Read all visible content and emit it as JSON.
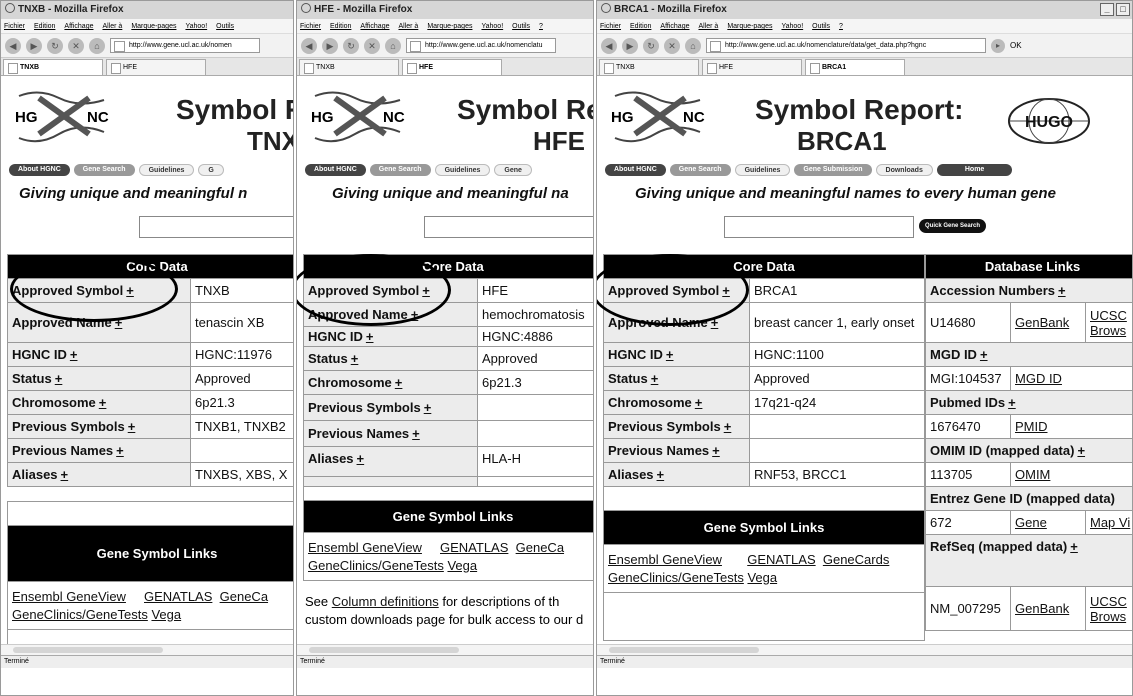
{
  "windows": [
    {
      "title": "TNXB - Mozilla Firefox",
      "menu": [
        "Fichier",
        "Edition",
        "Affichage",
        "Aller à",
        "Marque-pages",
        "Yahoo!",
        "Outils"
      ],
      "url": "http://www.gene.ucl.ac.uk/nomen",
      "tabs": [
        "TNXB",
        "HFE"
      ],
      "header_line1": "Symbol R",
      "header_line2": "TNX",
      "buttons": [
        "About HGNC",
        "Gene Search",
        "Guidelines",
        "G"
      ],
      "tagline": "Giving unique and meaningful n",
      "core_title": "Core Data",
      "rows": [
        {
          "label": "Approved Symbol",
          "value": "TNXB"
        },
        {
          "label": "Approved Name",
          "value": "tenascin XB"
        },
        {
          "label": "HGNC ID",
          "value": "HGNC:11976"
        },
        {
          "label": "Status",
          "value": "Approved"
        },
        {
          "label": "Chromosome",
          "value": "6p21.3"
        },
        {
          "label": "Previous Symbols",
          "value": "TNXB1, TNXB2"
        },
        {
          "label": "Previous Names",
          "value": ""
        },
        {
          "label": "Aliases",
          "value": "TNXBS, XBS, X"
        }
      ],
      "links_title": "Gene Symbol Links",
      "links": [
        "Ensembl GeneView",
        "GENATLAS",
        "GeneCa"
      ],
      "links2": [
        "GeneClinics/GeneTests",
        "Vega"
      ],
      "status_text": "Terminé"
    },
    {
      "title": "HFE - Mozilla Firefox",
      "menu": [
        "Fichier",
        "Edition",
        "Affichage",
        "Aller à",
        "Marque-pages",
        "Yahoo!",
        "Outils",
        "?"
      ],
      "url": "http://www.gene.ucl.ac.uk/nomenclatu",
      "tabs": [
        "TNXB",
        "HFE"
      ],
      "header_line1": "Symbol Re",
      "header_line2": "HFE",
      "buttons": [
        "About HGNC",
        "Gene Search",
        "Guidelines",
        "Gene"
      ],
      "tagline": "Giving unique and meaningful na",
      "core_title": "Core Data",
      "rows": [
        {
          "label": "Approved Symbol",
          "value": "HFE"
        },
        {
          "label": "Approved Name",
          "value": "hemochromatosis"
        },
        {
          "label": "HGNC ID",
          "value": "HGNC:4886"
        },
        {
          "label": "Status",
          "value": "Approved"
        },
        {
          "label": "Chromosome",
          "value": "6p21.3"
        },
        {
          "label": "Previous Symbols",
          "value": ""
        },
        {
          "label": "Previous Names",
          "value": ""
        },
        {
          "label": "Aliases",
          "value": "HLA-H"
        }
      ],
      "links_title": "Gene Symbol Links",
      "links": [
        "Ensembl GeneView",
        "GENATLAS",
        "GeneCa"
      ],
      "links2": [
        "GeneClinics/GeneTests",
        "Vega"
      ],
      "note_line1_pre": "See",
      "note_line1_link": "Column definitions",
      "note_line1_post": "for descriptions of th",
      "note_line2": "custom downloads page for bulk access to our d",
      "status_text": "Terminé"
    },
    {
      "title": "BRCA1 - Mozilla Firefox",
      "menu": [
        "Fichier",
        "Edition",
        "Affichage",
        "Aller à",
        "Marque-pages",
        "Yahoo!",
        "Outils",
        "?"
      ],
      "url": "http://www.gene.ucl.ac.uk/nomenclature/data/get_data.php?hgnc",
      "ok_label": "OK",
      "tabs": [
        "TNXB",
        "HFE",
        "BRCA1"
      ],
      "header_line1": "Symbol Report:",
      "header_line2": "BRCA1",
      "hugo_logo": "HUGO",
      "buttons": [
        "About HGNC",
        "Gene Search",
        "Guidelines",
        "Gene Submission",
        "Downloads",
        "Home"
      ],
      "tagline": "Giving unique and meaningful names to every human gene",
      "quick_search": "Quick Gene Search",
      "core_title": "Core Data",
      "db_title": "Database Links",
      "rows": [
        {
          "label": "Approved Symbol",
          "value": "BRCA1"
        },
        {
          "label": "Approved Name",
          "value": "breast cancer 1, early onset"
        },
        {
          "label": "HGNC ID",
          "value": "HGNC:1100"
        },
        {
          "label": "Status",
          "value": "Approved"
        },
        {
          "label": "Chromosome",
          "value": "17q21-q24"
        },
        {
          "label": "Previous Symbols",
          "value": ""
        },
        {
          "label": "Previous Names",
          "value": ""
        },
        {
          "label": "Aliases",
          "value": "RNF53, BRCC1"
        }
      ],
      "db": {
        "accession_label": "Accession Numbers",
        "accession": "U14680",
        "genbank": "GenBank",
        "ucsc": "UCSC",
        "browse": "Brows",
        "mgd_label": "MGD ID",
        "mgd": "MGI:104537",
        "mgd_link": "MGD ID",
        "pubmed_label": "Pubmed IDs",
        "pubmed": "1676470",
        "pmid": "PMID",
        "omim_label": "OMIM ID (mapped data)",
        "omim": "113705",
        "omim_link": "OMIM",
        "entrez_label": "Entrez Gene ID (mapped data)",
        "entrez": "672",
        "gene_link": "Gene",
        "mapview": "Map Vi",
        "refseq_label": "RefSeq (mapped data)",
        "refseq": "NM_007295",
        "genbank2": "GenBank",
        "ucsc2": "UCSC",
        "browse2": "Brows"
      },
      "links_title": "Gene Symbol Links",
      "links": [
        "Ensembl GeneView",
        "GENATLAS",
        "GeneCards"
      ],
      "links2": [
        "GeneClinics/GeneTests",
        "Vega"
      ],
      "status_text": "Terminé"
    }
  ],
  "plus_sign": "+"
}
